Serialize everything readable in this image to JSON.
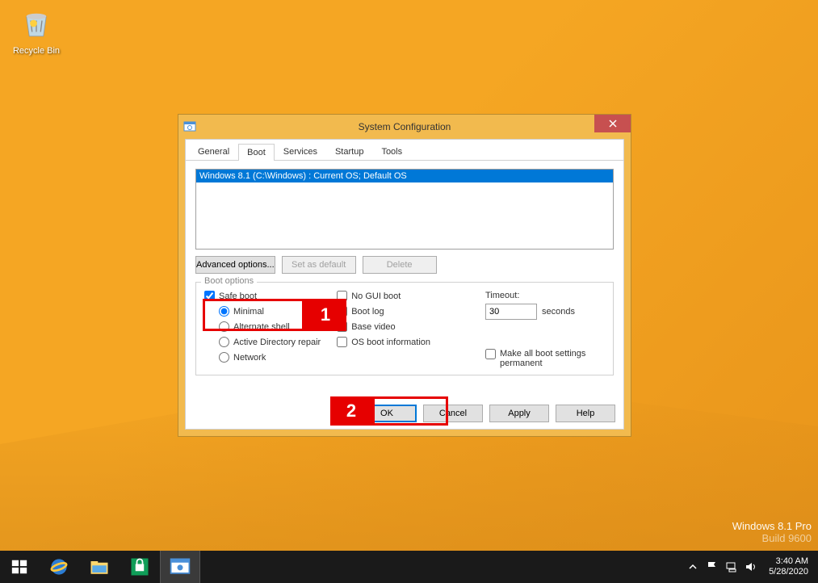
{
  "desktop": {
    "recycle_bin_label": "Recycle Bin",
    "watermark_line1": "Windows 8.1 Pro",
    "watermark_line2": "Build 9600"
  },
  "dialog": {
    "title": "System Configuration",
    "tabs": [
      "General",
      "Boot",
      "Services",
      "Startup",
      "Tools"
    ],
    "active_tab_index": 1,
    "os_list": [
      "Windows 8.1 (C:\\Windows) : Current OS; Default OS"
    ],
    "buttons": {
      "advanced": "Advanced options...",
      "set_default": "Set as default",
      "delete": "Delete"
    },
    "boot_options": {
      "group_title": "Boot options",
      "safe_boot": "Safe boot",
      "safe_boot_checked": true,
      "minimal": "Minimal",
      "alternate_shell": "Alternate shell",
      "ad_repair": "Active Directory repair",
      "network": "Network",
      "no_gui": "No GUI boot",
      "boot_log": "Boot log",
      "base_video": "Base video",
      "os_boot_info": "OS boot information",
      "timeout_label": "Timeout:",
      "timeout_value": "30",
      "seconds_label": "seconds",
      "permanent": "Make all boot settings permanent"
    },
    "footer": {
      "ok": "OK",
      "cancel": "Cancel",
      "apply": "Apply",
      "help": "Help"
    }
  },
  "annotations": {
    "label1": "1",
    "label2": "2"
  },
  "taskbar": {
    "clock_time": "3:40 AM",
    "clock_date": "5/28/2020"
  }
}
